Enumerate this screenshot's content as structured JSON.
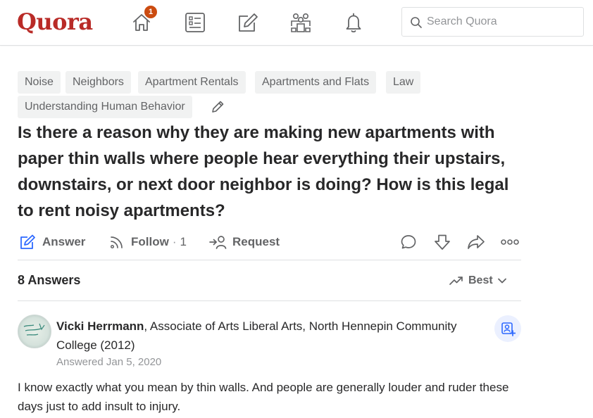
{
  "brand": {
    "logo": "Quora",
    "color": "#b92b27"
  },
  "nav": {
    "home_badge": "1",
    "icons": [
      "home-icon",
      "following-icon",
      "answer-icon",
      "spaces-icon",
      "notifications-icon"
    ]
  },
  "search": {
    "placeholder": "Search Quora",
    "value": ""
  },
  "topics": [
    "Noise",
    "Neighbors",
    "Apartment Rentals",
    "Apartments and Flats",
    "Law",
    "Understanding Human Behavior"
  ],
  "question": {
    "title": "Is there a reason why they are making new apartments with paper thin walls where people hear everything their upstairs, downstairs, or next door neighbor is doing? How is this legal to rent noisy apartments?"
  },
  "actions": {
    "answer": "Answer",
    "follow": "Follow",
    "follow_sep": "·",
    "follow_count": "1",
    "request": "Request"
  },
  "answers_header": {
    "count": "8 Answers",
    "sort": "Best"
  },
  "answer": {
    "author": "Vicki Herrmann",
    "credential": ", Associate of Arts Liberal Arts, North Hennepin Community College (2012)",
    "answered": "Answered Jan 5, 2020",
    "text": "I know exactly what you mean by thin walls. And people are generally louder and ruder these days just to add insult to injury."
  },
  "colors": {
    "accent_blue": "#2e69ff",
    "badge": "#cb4b10",
    "muted": "#636466"
  }
}
